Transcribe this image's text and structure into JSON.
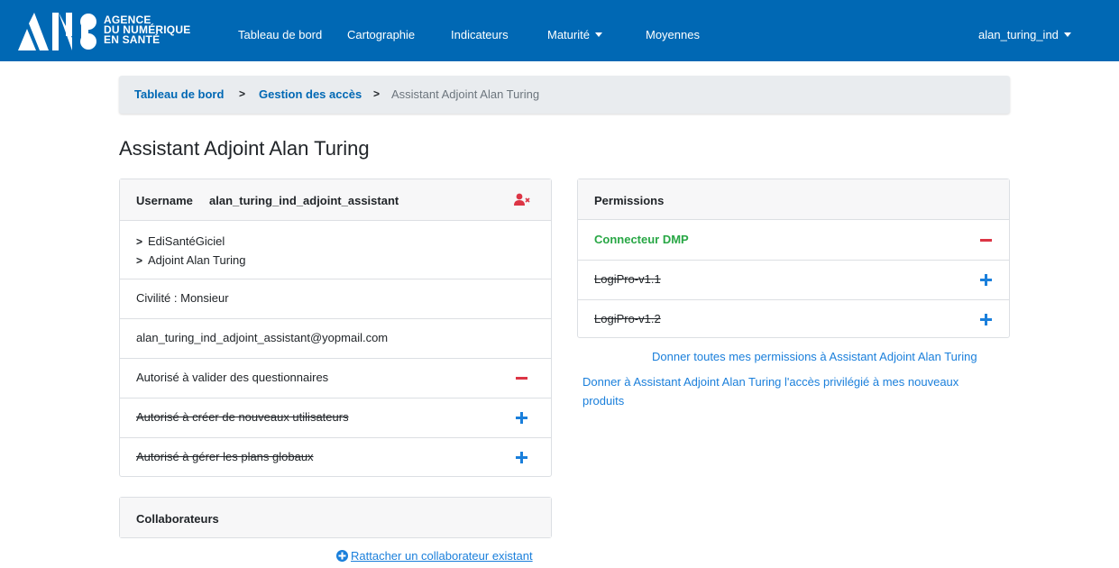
{
  "navbar": {
    "logo_lines": [
      "AGENCE",
      "DU NUMÉRIQUE",
      "EN SANTÉ"
    ],
    "items": [
      "Tableau de bord",
      "Cartographie",
      "Indicateurs",
      "Maturité",
      "Moyennes"
    ],
    "user": "alan_turing_ind",
    "brand_color": "#0068b4"
  },
  "breadcrumb": {
    "items": [
      "Tableau de bord",
      "Gestion des accès",
      "Assistant Adjoint Alan Turing"
    ],
    "separator": ">"
  },
  "page_title": "Assistant Adjoint Alan Turing",
  "user_card": {
    "username_label": "Username",
    "username_value": "alan_turing_ind_adjoint_assistant",
    "remove_icon": "user-times-icon",
    "hierarchy": [
      "EdiSantéGiciel",
      "Adjoint Alan Turing"
    ],
    "civilite": "Civilité : Monsieur",
    "email": "alan_turing_ind_adjoint_assistant@yopmail.com",
    "rights": [
      {
        "label": "Autorisé à valider des questionnaires",
        "granted": true
      },
      {
        "label": "Autorisé à créer de nouveaux utilisateurs",
        "granted": false
      },
      {
        "label": "Autorisé à gérer les plans globaux",
        "granted": false
      }
    ]
  },
  "collaborators": {
    "header": "Collaborateurs",
    "attach_link": "Rattacher un collaborateur existant"
  },
  "permissions": {
    "header": "Permissions",
    "items": [
      {
        "label": "Connecteur DMP",
        "granted": true
      },
      {
        "label": "LogiPro-v1.1",
        "granted": false
      },
      {
        "label": "LogiPro-v1.2",
        "granted": false
      }
    ],
    "give_all_link": "Donner toutes mes permissions à Assistant Adjoint Alan Turing",
    "give_priv_link_line1": "Donner à Assistant Adjoint Alan Turing l'accès privilégié à mes nouveaux",
    "give_priv_link_line2": "produits"
  },
  "colors": {
    "success": "#28a745",
    "danger": "#dc3545",
    "link": "#1a7fdb"
  }
}
